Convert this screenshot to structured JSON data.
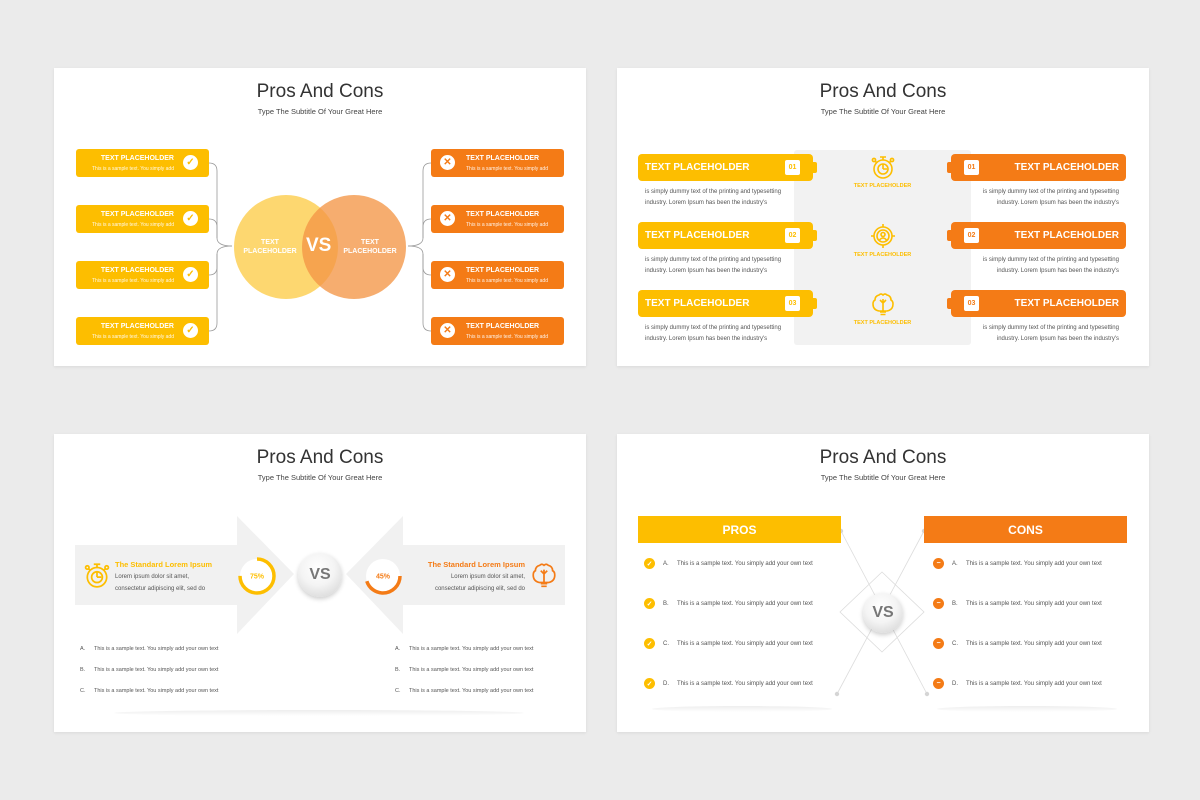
{
  "colors": {
    "pro": "#fdbe00",
    "con": "#f47b16",
    "background": "#ebebeb"
  },
  "slides": [
    {
      "title": "Pros And Cons",
      "subtitle": "Type The Subtitle Of Your Great Here",
      "pros": [
        {
          "heading": "TEXT PLACEHOLDER",
          "text": "This is a sample text. You simply add",
          "icon": "check-circle-icon"
        },
        {
          "heading": "TEXT PLACEHOLDER",
          "text": "This is a sample text. You simply add",
          "icon": "check-circle-icon"
        },
        {
          "heading": "TEXT PLACEHOLDER",
          "text": "This is a sample text. You simply add",
          "icon": "check-circle-icon"
        },
        {
          "heading": "TEXT PLACEHOLDER",
          "text": "This is a sample text. You simply add",
          "icon": "check-circle-icon"
        }
      ],
      "cons": [
        {
          "heading": "TEXT PLACEHOLDER",
          "text": "This is a sample text. You simply add",
          "icon": "x-circle-icon"
        },
        {
          "heading": "TEXT PLACEHOLDER",
          "text": "This is a sample text. You simply add",
          "icon": "x-circle-icon"
        },
        {
          "heading": "TEXT PLACEHOLDER",
          "text": "This is a sample text. You simply add",
          "icon": "x-circle-icon"
        },
        {
          "heading": "TEXT PLACEHOLDER",
          "text": "This is a sample text. You simply add",
          "icon": "x-circle-icon"
        }
      ],
      "venn": {
        "left": "TEXT PLACEHOLDER",
        "right": "TEXT PLACEHOLDER",
        "center": "VS"
      }
    },
    {
      "title": "Pros And Cons",
      "subtitle": "Type The Subtitle Of Your Great Here",
      "pros": [
        {
          "heading": "TEXT PLACEHOLDER",
          "num": "01",
          "text1": "is simply dummy text of the printing and typesetting",
          "text2": "industry. Lorem Ipsum has been the industry's"
        },
        {
          "heading": "TEXT PLACEHOLDER",
          "num": "02",
          "text1": "is simply dummy text of the printing and typesetting",
          "text2": "industry. Lorem Ipsum has been the industry's"
        },
        {
          "heading": "TEXT PLACEHOLDER",
          "num": "03",
          "text1": "is simply dummy text of the printing and typesetting",
          "text2": "industry. Lorem Ipsum has been the industry's"
        }
      ],
      "cons": [
        {
          "heading": "TEXT PLACEHOLDER",
          "num": "01",
          "text1": "is simply dummy text of the printing and typesetting",
          "text2": "industry. Lorem Ipsum has been the industry's"
        },
        {
          "heading": "TEXT PLACEHOLDER",
          "num": "02",
          "text1": "is simply dummy text of the printing and typesetting",
          "text2": "industry. Lorem Ipsum has been the industry's"
        },
        {
          "heading": "TEXT PLACEHOLDER",
          "num": "03",
          "text1": "is simply dummy text of the printing and typesetting",
          "text2": "industry. Lorem Ipsum has been the industry's"
        }
      ],
      "center": [
        {
          "icon": "stopwatch-icon",
          "label": "TEXT PLACEHOLDER"
        },
        {
          "icon": "target-user-icon",
          "label": "TEXT PLACEHOLDER"
        },
        {
          "icon": "brain-bulb-icon",
          "label": "TEXT PLACEHOLDER"
        }
      ]
    },
    {
      "title": "Pros And Cons",
      "subtitle": "Type The Subtitle Of Your Great Here",
      "left": {
        "heading": "The Standard Lorem Ipsum",
        "line1": "Lorem ipsum dolor sit amet,",
        "line2": "consectetur adipiscing elit, sed do",
        "percent": 75,
        "percent_label": "75%",
        "icon": "stopwatch-icon"
      },
      "right": {
        "heading": "The Standard Lorem Ipsum",
        "line1": "Lorem ipsum dolor sit amet,",
        "line2": "consectetur adipiscing elit, sed do",
        "percent": 45,
        "percent_label": "45%",
        "icon": "brain-bulb-icon"
      },
      "vs": "VS",
      "left_list": [
        {
          "key": "A.",
          "text": "This is a sample text. You simply add your own text"
        },
        {
          "key": "B.",
          "text": "This is a sample text. You simply add your own text"
        },
        {
          "key": "C.",
          "text": "This is a sample text. You simply add your own text"
        }
      ],
      "right_list": [
        {
          "key": "A.",
          "text": "This is a sample text. You simply add your own text"
        },
        {
          "key": "B.",
          "text": "This is a sample text. You simply add your own text"
        },
        {
          "key": "C.",
          "text": "This is a sample text. You simply add your own text"
        }
      ]
    },
    {
      "title": "Pros And Cons",
      "subtitle": "Type The Subtitle Of Your Great Here",
      "pros_label": "PROS",
      "cons_label": "CONS",
      "vs": "VS",
      "pros": [
        {
          "key": "A.",
          "text": "This is a sample text. You simply add your own text"
        },
        {
          "key": "B.",
          "text": "This is a sample text. You simply add your own text"
        },
        {
          "key": "C.",
          "text": "This is a sample text. You simply add your own text"
        },
        {
          "key": "D.",
          "text": "This is a sample text. You simply add your own text"
        }
      ],
      "cons": [
        {
          "key": "A.",
          "text": "This is a sample text. You simply add your own text"
        },
        {
          "key": "B.",
          "text": "This is a sample text. You simply add your own text"
        },
        {
          "key": "C.",
          "text": "This is a sample text. You simply add your own text"
        },
        {
          "key": "D.",
          "text": "This is a sample text. You simply add your own text"
        }
      ]
    }
  ]
}
